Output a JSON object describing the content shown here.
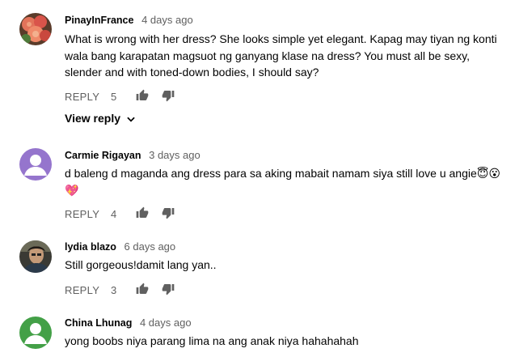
{
  "comments": [
    {
      "author": "PinayInFrance",
      "time": "4 days ago",
      "lines": [
        "What is wrong with her dress? She looks simple yet elegant. Kapag may tiyan ng konti",
        "wala bang karapatan magsuot ng ganyang klase na dress? You must all be  sexy,",
        "slender and with toned-down bodies, I should say?"
      ],
      "reply_label": "REPLY",
      "likes": "5",
      "view_reply": "View reply",
      "avatar": "roses-photo"
    },
    {
      "author": "Carmie Rigayan",
      "time": "3 days ago",
      "lines": [
        "d baleng d maganda ang dress  para sa aking mabait namam siya still love u angie😇😮",
        "💖"
      ],
      "reply_label": "REPLY",
      "likes": "4",
      "avatar": "default-user-purple"
    },
    {
      "author": "lydia blazo",
      "time": "6 days ago",
      "lines": [
        "Still gorgeous!damit lang yan.."
      ],
      "reply_label": "REPLY",
      "likes": "3",
      "avatar": "person-photo"
    },
    {
      "author": "China Lhunag",
      "time": "4 days ago",
      "lines": [
        "yong boobs niya parang lima na ang anak niya hahahahah"
      ],
      "avatar": "default-user-green"
    }
  ],
  "colors": {
    "meta": "#606060",
    "text": "#030303",
    "purple_avatar": "#9575cd",
    "green_avatar": "#43a047"
  }
}
